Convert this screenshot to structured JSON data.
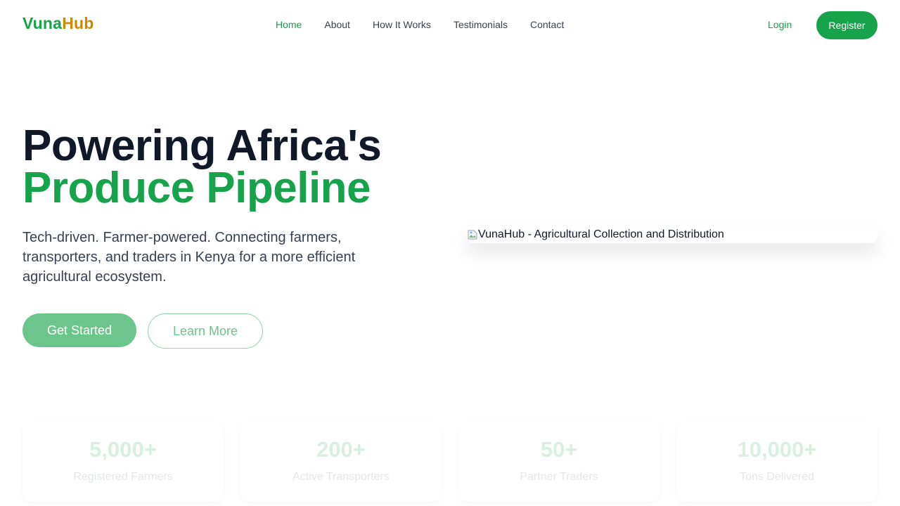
{
  "brand": {
    "logo_part1": "Vuna",
    "logo_part2": "Hub",
    "primary_color": "#16a34a",
    "accent_color": "#ca8a04"
  },
  "nav": {
    "links": [
      {
        "label": "Home"
      },
      {
        "label": "About"
      },
      {
        "label": "How It Works"
      },
      {
        "label": "Testimonials"
      },
      {
        "label": "Contact"
      }
    ],
    "login_label": "Login",
    "register_label": "Register"
  },
  "hero": {
    "title_line1": "Powering Africa's",
    "title_line2": "Produce Pipeline",
    "subtitle": "Tech-driven. Farmer-powered. Connecting farmers, transporters, and traders in Kenya for a more efficient agricultural ecosystem.",
    "primary_cta": "Get Started",
    "secondary_cta": "Learn More",
    "image_alt": "VunaHub - Agricultural Collection and Distribution",
    "image_icon": "broken-image-icon"
  },
  "stats": [
    {
      "value": "5,000+",
      "label": "Registered Farmers"
    },
    {
      "value": "200+",
      "label": "Active Transporters"
    },
    {
      "value": "50+",
      "label": "Partner Traders"
    },
    {
      "value": "10,000+",
      "label": "Tons Delivered"
    }
  ]
}
